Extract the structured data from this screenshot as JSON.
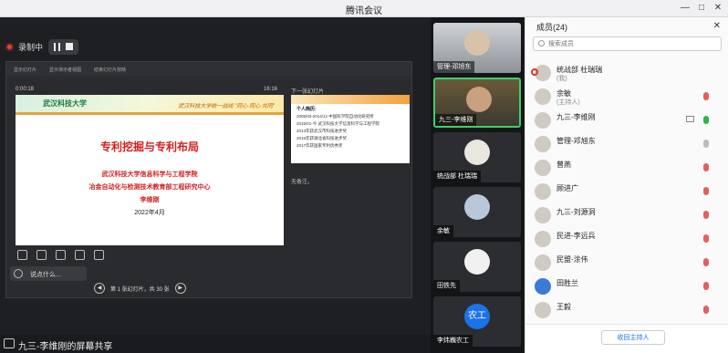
{
  "window": {
    "title": "腾讯会议"
  },
  "recording": {
    "label": "录制中"
  },
  "share_toolbar": {
    "items": [
      "显示幻灯片",
      "显示演示者视图",
      "结束幻灯片放映"
    ]
  },
  "presenter": {
    "elapsed": "0:00:18",
    "clock": "16:16",
    "next_label": "下一张幻灯片",
    "notes": "无备注。",
    "page_label": "第 1 张幻灯片，共 30 张"
  },
  "slide": {
    "logo": "武汉科技大学",
    "motto": "武汉科技大学统一战线 \"同心·同心 共同\"",
    "title": "专利挖掘与专利布局",
    "line1": "武汉科技大学信息科学与工程学院",
    "line2": "冶金自动化与检测技术教育部工程研究中心",
    "author": "李维刚",
    "date": "2022年4月"
  },
  "next_slide": {
    "heading": "个人简历:",
    "lines": [
      "2005/03-2014/12 中国科学院自动化研究所",
      "2015/01-今 武汉科技大学信息科学与工程学院",
      "",
      "2013年获武汉市科技进步奖",
      "2015年获湖北省科技进步奖",
      "2017年获国家专利优秀奖"
    ]
  },
  "chat": {
    "placeholder": "说点什么..."
  },
  "status": {
    "share_text": "九三-李维刚的屏幕共享"
  },
  "video_tiles": [
    {
      "name": "管理-邓旭东"
    },
    {
      "name": "九三-李维刚"
    },
    {
      "name": "统战部 杜瑞瑞"
    },
    {
      "name": "余敏"
    },
    {
      "name": "田铁先"
    },
    {
      "name": "李炜巍农工",
      "avatar_text": "农工"
    }
  ],
  "members_panel": {
    "title": "成员(24)",
    "search_placeholder": "搜索成员",
    "host_button": "收回主持人",
    "members": [
      {
        "name": "统战部 杜瑞瑞",
        "sub": "(我)"
      },
      {
        "name": "余敏",
        "sub": "(主持人)"
      },
      {
        "name": "九三-李维刚",
        "sub": ""
      },
      {
        "name": "管理-邓旭东",
        "sub": ""
      },
      {
        "name": "曾燕",
        "sub": ""
      },
      {
        "name": "顾进广",
        "sub": ""
      },
      {
        "name": "九三-刘源洞",
        "sub": ""
      },
      {
        "name": "民进-李远兵",
        "sub": ""
      },
      {
        "name": "民盟-涂伟",
        "sub": ""
      },
      {
        "name": "田胜兰",
        "sub": ""
      },
      {
        "name": "王毅",
        "sub": ""
      }
    ]
  }
}
